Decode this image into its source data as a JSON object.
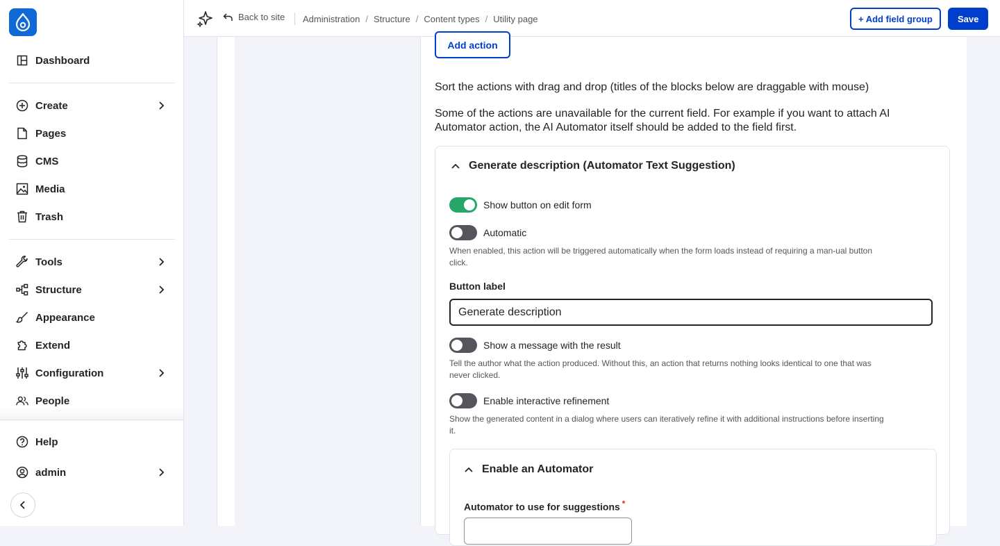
{
  "sidebar": {
    "logo_icon": "drupal-drop-icon",
    "items": [
      {
        "label": "Dashboard",
        "icon": "dashboard-icon"
      },
      {
        "label": "Create",
        "icon": "plus-circle-icon",
        "has_children": true
      },
      {
        "label": "Pages",
        "icon": "file-icon"
      },
      {
        "label": "CMS",
        "icon": "database-icon"
      },
      {
        "label": "Media",
        "icon": "image-icon"
      },
      {
        "label": "Trash",
        "icon": "trash-icon"
      },
      {
        "label": "Tools",
        "icon": "wrench-icon",
        "has_children": true
      },
      {
        "label": "Structure",
        "icon": "structure-icon",
        "has_children": true
      },
      {
        "label": "Appearance",
        "icon": "brush-icon"
      },
      {
        "label": "Extend",
        "icon": "puzzle-icon"
      },
      {
        "label": "Configuration",
        "icon": "sliders-icon",
        "has_children": true
      },
      {
        "label": "People",
        "icon": "people-icon"
      }
    ],
    "bottom": [
      {
        "label": "Help",
        "icon": "help-icon"
      },
      {
        "label": "admin",
        "icon": "user-icon",
        "has_children": true
      }
    ]
  },
  "topbar": {
    "back_label": "Back to site",
    "breadcrumbs": [
      "Administration",
      "Structure",
      "Content types",
      "Utility page"
    ],
    "add_field_group_label": "+ Add field group",
    "save_label": "Save"
  },
  "main": {
    "add_action_label": "Add action",
    "sort_text": "Sort the actions with drag and drop (titles of the blocks below are draggable with mouse)",
    "unavailable_text": "Some of the actions are unavailable for the current field. For example if you want to attach AI Automator action, the AI Automator itself should be added to the field first.",
    "card": {
      "title": "Generate description (Automator Text Suggestion)",
      "show_button_label": "Show button on edit form",
      "show_button_on": true,
      "automatic_label": "Automatic",
      "automatic_on": false,
      "automatic_desc": "When enabled, this action will be triggered automatically when the form loads instead of requiring a man-ual button click.",
      "button_label_title": "Button label",
      "button_label_value": "Generate description",
      "show_message_label": "Show a message with the result",
      "show_message_on": false,
      "show_message_desc": "Tell the author what the action produced. Without this, an action that returns nothing looks identical to one that was never clicked.",
      "interactive_label": "Enable interactive refinement",
      "interactive_on": false,
      "interactive_desc": "Show the generated content in a dialog where users can iteratively refine it with additional instructions before inserting it.",
      "subcard": {
        "title": "Enable an Automator",
        "field_label": "Automator to use for suggestions",
        "required_mark": "*"
      }
    }
  },
  "colors": {
    "accent": "#003ecc",
    "toggle_on": "#26a769",
    "toggle_off": "#55565b",
    "logo": "#0f69d6"
  }
}
